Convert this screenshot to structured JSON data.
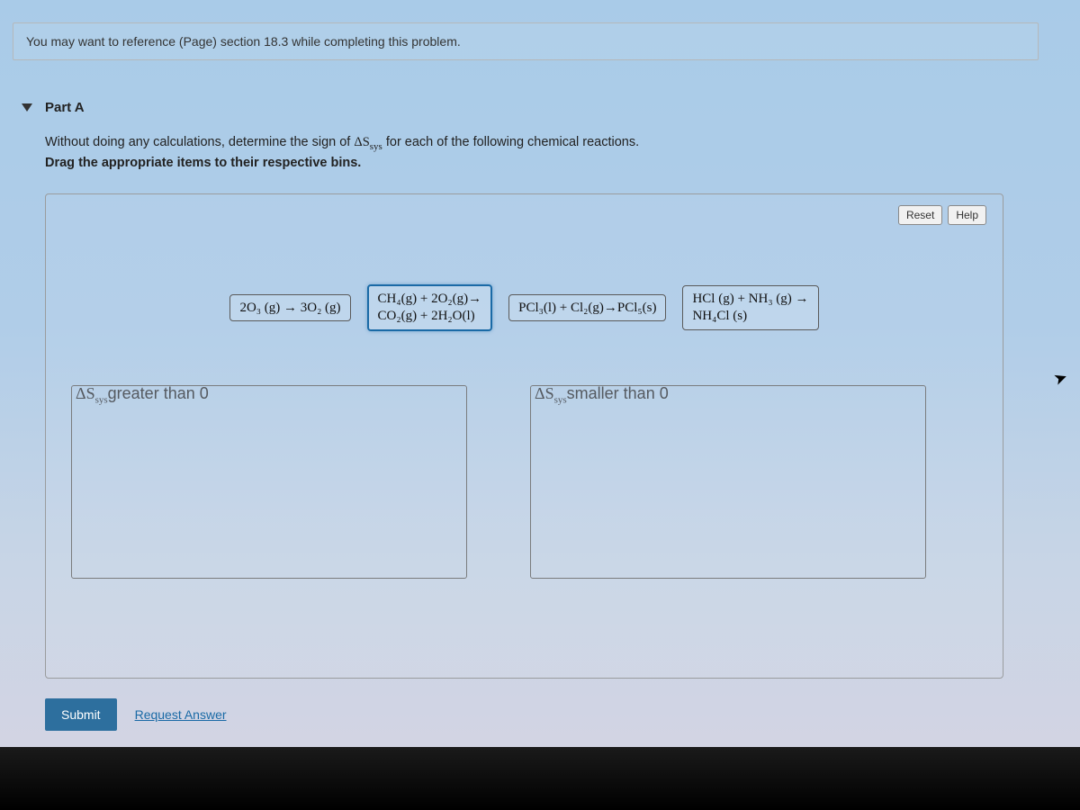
{
  "reference_text": "You may want to reference (Page) section 18.3 while completing this problem.",
  "part": {
    "label": "Part A",
    "line1_a": "Without doing any calculations, determine the sign of ",
    "line1_delta": "ΔS",
    "line1_sub": "sys",
    "line1_b": " for each of the following chemical reactions.",
    "line2": "Drag the appropriate items to their respective bins."
  },
  "buttons": {
    "reset": "Reset",
    "help": "Help",
    "submit": "Submit",
    "request": "Request Answer"
  },
  "tiles": {
    "t1": "2O₃ (g) → 3O₂ (g)",
    "t2a": "CH₄(g) + 2O₂(g)→",
    "t2b": "CO₂(g) + 2H₂O(l)",
    "t3": "PCl₃(l) + Cl₂(g)→PCl₅(s)",
    "t4a": "HCl (g) + NH₃ (g) →",
    "t4b": "NH₄Cl (s)"
  },
  "bins": {
    "left_a": "ΔS",
    "left_sub": "sys",
    "left_b": "greater than 0",
    "right_a": "ΔS",
    "right_sub": "sys",
    "right_b": "smaller than 0"
  }
}
